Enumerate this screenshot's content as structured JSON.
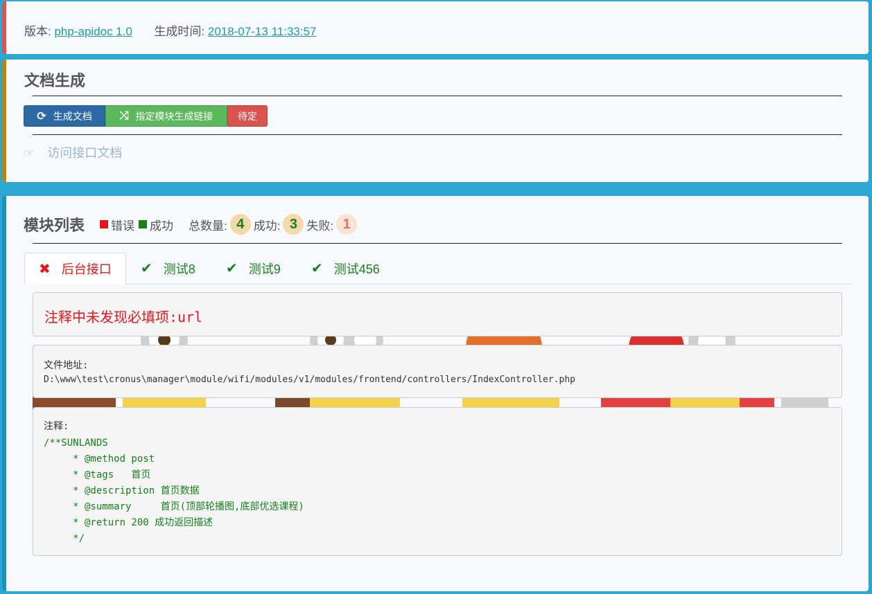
{
  "version": {
    "version_label": "版本:",
    "version_value": "php-apidoc 1.0",
    "time_label": "生成时间:",
    "time_value": "2018-07-13 11:33:57"
  },
  "doc_gen": {
    "title": "文档生成",
    "buttons": [
      {
        "label": "生成文档",
        "icon": "refresh-icon",
        "color": "#2d6aa5"
      },
      {
        "label": "指定模块生成链接",
        "icon": "shuffle-icon",
        "color": "#5cb85c"
      },
      {
        "label": "待定",
        "icon": "",
        "color": "#d9534f"
      }
    ],
    "visit_link": "访问接口文档",
    "visit_icon": "hand-point-right-icon"
  },
  "modules": {
    "title": "模块列表",
    "legend": [
      {
        "label": "错误",
        "color": "#e8151b"
      },
      {
        "label": "成功",
        "color": "#16801b"
      }
    ],
    "stats": {
      "total_label": "总数量:",
      "total": "4",
      "success_label": "成功:",
      "success": "3",
      "fail_label": "失败:",
      "fail": "1"
    },
    "tabs": [
      {
        "label": "后台接口",
        "status": "error",
        "icon": "cross-icon",
        "active": true
      },
      {
        "label": "测试8",
        "status": "success",
        "icon": "check-icon",
        "active": false
      },
      {
        "label": "测试9",
        "status": "success",
        "icon": "check-icon",
        "active": false
      },
      {
        "label": "测试456",
        "status": "success",
        "icon": "check-icon",
        "active": false
      }
    ],
    "error_message": "注释中未发现必填项",
    "error_field": ":url",
    "file_label": "文件地址:",
    "file_path": "D:\\www\\test\\cronus\\manager\\module/wifi/modules/v1/modules/frontend/controllers/IndexController.php",
    "note_label": "注释:",
    "note_lines": [
      "/**SUNLANDS",
      "     * @method post",
      "     * @tags   首页",
      "     * @description 首页数据",
      "     * @summary     首页(顶部轮播图,底部优选课程)",
      "     * @return 200 成功返回描述",
      "     */"
    ]
  }
}
